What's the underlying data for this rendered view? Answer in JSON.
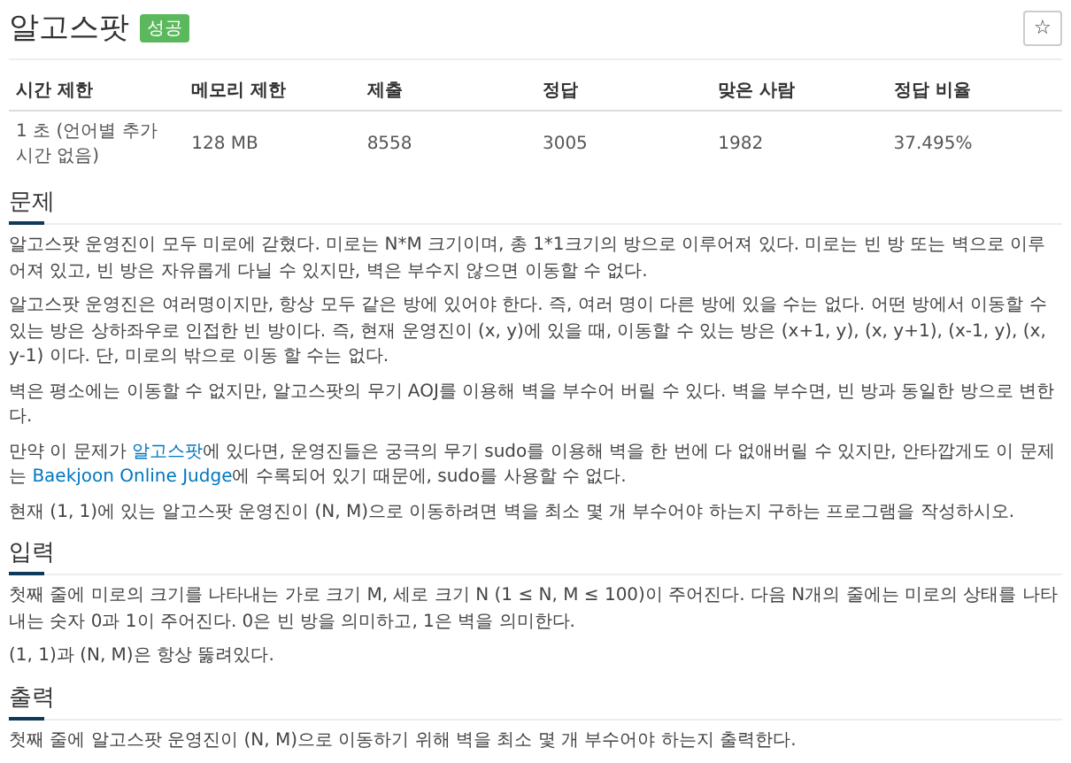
{
  "title": "알고스팟",
  "badge": "성공",
  "star_button": "☆",
  "info_table": {
    "columns": [
      "시간 제한",
      "메모리 제한",
      "제출",
      "정답",
      "맞은 사람",
      "정답 비율"
    ],
    "rows": [
      [
        "1 초 (언어별 추가 시간 없음)",
        "128 MB",
        "8558",
        "3005",
        "1982",
        "37.495%"
      ]
    ]
  },
  "sections": [
    {
      "heading": "문제",
      "paragraphs": [
        [
          {
            "text": "알고스팟 운영진이 모두 미로에 갇혔다. 미로는 N*M 크기이며, 총 1*1크기의 방으로 이루어져 있다. 미로는 빈 방 또는 벽으로 이루어져 있고, 빈 방은 자유롭게 다닐 수 있지만, 벽은 부수지 않으면 이동할 수 없다.",
            "link": false
          }
        ],
        [
          {
            "text": "알고스팟 운영진은 여러명이지만, 항상 모두 같은 방에 있어야 한다. 즉, 여러 명이 다른 방에 있을 수는 없다. 어떤 방에서 이동할 수 있는 방은 상하좌우로 인접한 빈 방이다. 즉, 현재 운영진이 (x, y)에 있을 때, 이동할 수 있는 방은 (x+1, y), (x, y+1), (x-1, y), (x, y-1) 이다. 단, 미로의 밖으로 이동 할 수는 없다.",
            "link": false
          }
        ],
        [
          {
            "text": "벽은 평소에는 이동할 수 없지만, 알고스팟의 무기 AOJ를 이용해 벽을 부수어 버릴 수 있다. 벽을 부수면, 빈 방과 동일한 방으로 변한다.",
            "link": false
          }
        ],
        [
          {
            "text": "만약 이 문제가 ",
            "link": false
          },
          {
            "text": "알고스팟",
            "link": true
          },
          {
            "text": "에 있다면, 운영진들은 궁극의 무기 sudo를 이용해 벽을 한 번에 다 없애버릴 수 있지만, 안타깝게도 이 문제는 ",
            "link": false
          },
          {
            "text": "Baekjoon Online Judge",
            "link": true
          },
          {
            "text": "에 수록되어 있기 때문에, sudo를 사용할 수 없다.",
            "link": false
          }
        ],
        [
          {
            "text": "현재 (1, 1)에 있는 알고스팟 운영진이 (N, M)으로 이동하려면 벽을 최소 몇 개 부수어야 하는지 구하는 프로그램을 작성하시오.",
            "link": false
          }
        ]
      ]
    },
    {
      "heading": "입력",
      "paragraphs": [
        [
          {
            "text": "첫째 줄에 미로의 크기를 나타내는 가로 크기 M, 세로 크기 N (1 ≤ N, M ≤ 100)이 주어진다. 다음 N개의 줄에는 미로의 상태를 나타내는 숫자 0과 1이 주어진다. 0은 빈 방을 의미하고, 1은 벽을 의미한다.",
            "link": false
          }
        ],
        [
          {
            "text": "(1, 1)과 (N, M)은 항상 뚫려있다.",
            "link": false
          }
        ]
      ]
    },
    {
      "heading": "출력",
      "paragraphs": [
        [
          {
            "text": "첫째 줄에 알고스팟 운영진이 (N, M)으로 이동하기 위해 벽을 최소 몇 개 부수어야 하는지 출력한다.",
            "link": false
          }
        ]
      ]
    }
  ]
}
